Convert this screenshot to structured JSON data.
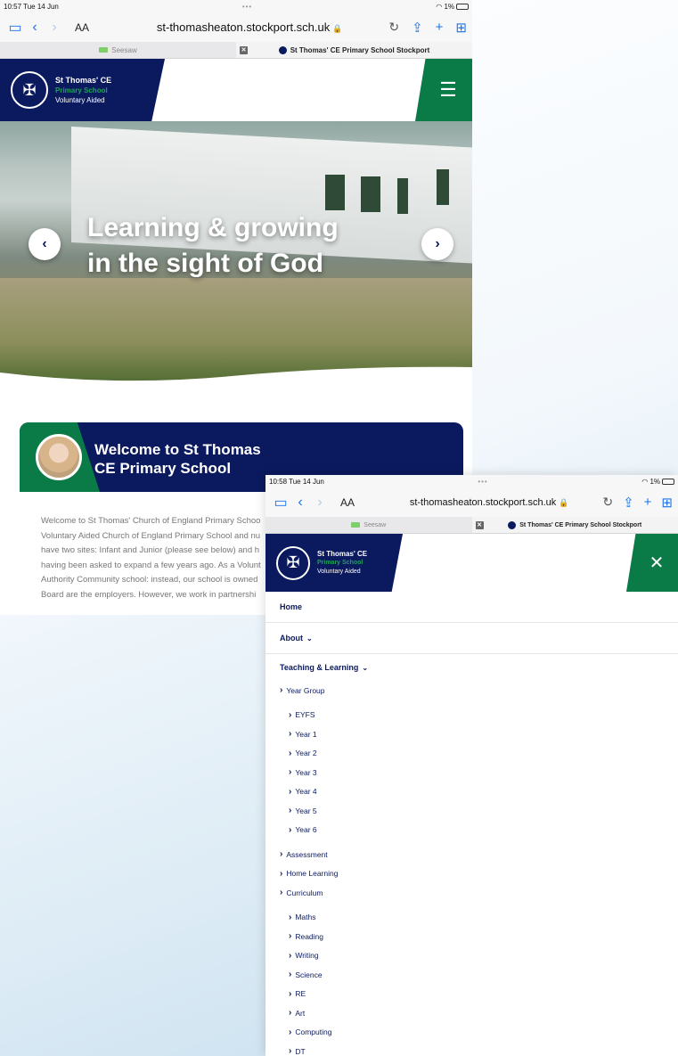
{
  "shot1": {
    "status": {
      "time": "10:57",
      "date": "Tue 14 Jun",
      "battery": "1%"
    },
    "browser": {
      "aa": "AA",
      "url": "st-thomasheaton.stockport.sch.uk",
      "lock": "🔒"
    },
    "tabs": [
      {
        "label": "Seesaw",
        "active": false
      },
      {
        "label": "St Thomas' CE Primary School Stockport",
        "active": true
      }
    ],
    "site": {
      "name": "St Thomas' CE",
      "subname": "Primary School",
      "tag": "Voluntary Aided"
    },
    "hero": {
      "line1": "Learning & growing",
      "line2": "in the sight of God"
    },
    "welcome": {
      "title_line1": "Welcome to St Thomas",
      "title_line2": "CE Primary School",
      "body": [
        "Welcome to St Thomas' Church of England Primary Schoo",
        "Voluntary Aided Church of England Primary School and nu",
        "have two sites: Infant and Junior (please see below) and h",
        "having been asked to expand a few years ago.  As a Volunt",
        "Authority Community school: instead, our school is owned",
        "Board are the employers.  However, we work in partnershi"
      ]
    }
  },
  "shot2": {
    "status": {
      "time": "10:58",
      "date": "Tue 14 Jun",
      "battery": "1%"
    },
    "browser": {
      "aa": "AA",
      "url": "st-thomasheaton.stockport.sch.uk",
      "lock": "🔒"
    },
    "tabs": [
      {
        "label": "Seesaw",
        "active": false
      },
      {
        "label": "St Thomas' CE Primary School Stockport",
        "active": true
      }
    ],
    "site": {
      "name": "St Thomas' CE",
      "subname": "Primary School",
      "tag": "Voluntary Aided"
    },
    "nav": {
      "home": "Home",
      "about": "About",
      "teaching": "Teaching & Learning",
      "year_group": "Year Group",
      "years": [
        "EYFS",
        "Year 1",
        "Year 2",
        "Year 3",
        "Year 4",
        "Year 5",
        "Year 6"
      ],
      "assessment": "Assessment",
      "home_learning": "Home Learning",
      "curriculum": "Curriculum",
      "subjects": [
        "Maths",
        "Reading",
        "Writing",
        "Science",
        "RE",
        "Art",
        "Computing",
        "DT"
      ]
    }
  },
  "colors": {
    "navy": "#0b1a5e",
    "green": "#0a7a46",
    "link_blue": "#1a73e8"
  },
  "icons": [
    "sidebar-icon",
    "back-icon",
    "forward-icon",
    "reload-icon",
    "share-icon",
    "plus-icon",
    "tabs-grid-icon",
    "hamburger-icon",
    "close-icon",
    "chevron-left-icon",
    "chevron-right-icon",
    "wifi-icon",
    "battery-icon"
  ]
}
